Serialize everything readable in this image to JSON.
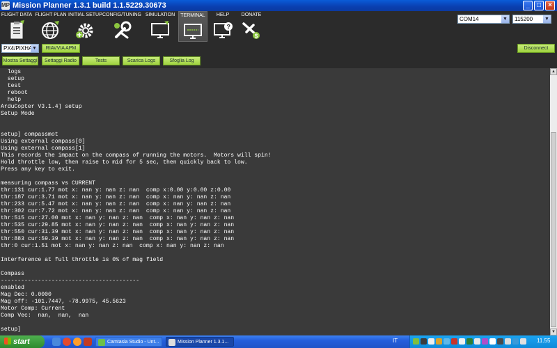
{
  "window": {
    "title": "Mission Planner 1.3.1 build 1.1.5229.30673",
    "app_icon": "mp-logo-icon"
  },
  "menu": [
    {
      "label": "FLIGHT DATA",
      "icon": "clipboard-icon"
    },
    {
      "label": "FLIGHT PLAN",
      "icon": "globe-icon"
    },
    {
      "label": "INITIAL SETUP",
      "icon": "gear-plus-icon"
    },
    {
      "label": "CONFIG/TUNING",
      "icon": "wrench-icon"
    },
    {
      "label": "SIMULATION",
      "icon": "monitor-icon"
    },
    {
      "label": "TERMINAL",
      "icon": "terminal-monitor-icon",
      "active": true
    },
    {
      "label": "HELP",
      "icon": "help-monitor-icon"
    },
    {
      "label": "DONATE",
      "icon": "plane-dollar-icon"
    }
  ],
  "connection": {
    "port": "COM14",
    "baud": "115200"
  },
  "toolbar": {
    "board_select": "PX4/PIXHA",
    "reboot_label": "RIAVVIA APM",
    "disconnect_label": "Disconnect",
    "buttons": [
      "Mostra Settaggi",
      "Settaggi Radio",
      "Tests",
      "Scarica Logs",
      "Sfoglia Log"
    ]
  },
  "terminal": {
    "lines": [
      "  logs",
      "  setup",
      "  test",
      "  reboot",
      "  help",
      "ArduCopter V3.1.4] setup",
      "Setup Mode",
      "",
      "",
      "setup] compassmot",
      "Using external compass[0]",
      "Using external compass[1]",
      "This records the impact on the compass of running the motors.  Motors will spin!",
      "Hold throttle low, then raise to mid for 5 sec, then quickly back to low.",
      "Press any key to exit.",
      "",
      "measuring compass vs CURRENT",
      "thr:131 cur:1.77 mot x: nan y: nan z: nan  comp x:0.00 y:0.00 z:0.00",
      "thr:187 cur:3.71 mot x: nan y: nan z: nan  comp x: nan y: nan z: nan",
      "thr:233 cur:5.47 mot x: nan y: nan z: nan  comp x: nan y: nan z: nan",
      "thr:302 cur:7.72 mot x: nan y: nan z: nan  comp x: nan y: nan z: nan",
      "thr:515 cur:27.00 mot x: nan y: nan z: nan  comp x: nan y: nan z: nan",
      "thr:535 cur:29.85 mot x: nan y: nan z: nan  comp x: nan y: nan z: nan",
      "thr:550 cur:31.39 mot x: nan y: nan z: nan  comp x: nan y: nan z: nan",
      "thr:883 cur:59.39 mot x: nan y: nan z: nan  comp x: nan y: nan z: nan",
      "thr:0 cur:1.51 mot x: nan y: nan z: nan  comp x: nan y: nan z: nan",
      "",
      "Interference at full throttle is 0% of mag field",
      "",
      "Compass",
      "-----------------------------------------",
      "enabled",
      "Mag Dec: 0.0000",
      "Mag off: -101.7447, -78.9975, 45.5623",
      "Motor Comp: Current",
      "Comp Vec:  nan,  nan,  nan",
      "",
      "setup]"
    ]
  },
  "taskbar": {
    "start_label": "start",
    "tasks": [
      {
        "label": "Camtasia Studio - Unt...",
        "active": false
      },
      {
        "label": "Mission Planner 1.3.1...",
        "active": true
      }
    ],
    "language": "IT",
    "clock": "11.55"
  }
}
